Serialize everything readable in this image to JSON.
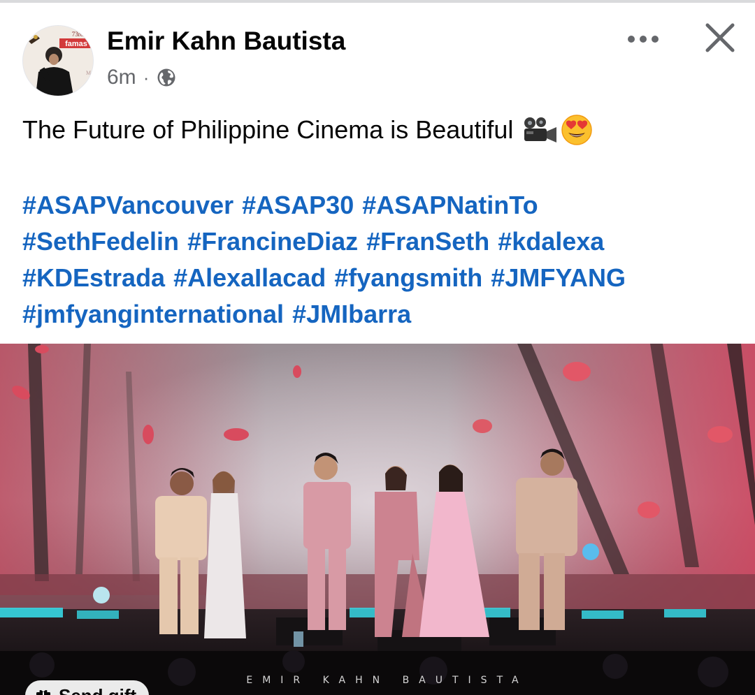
{
  "author": {
    "name": "Emir Kahn Bautista",
    "timestamp": "6m",
    "separator": "·",
    "privacy_icon": "globe-icon",
    "avatar_badge_text": "famas",
    "avatar_badge_number": "73rd"
  },
  "actions": {
    "more_icon": "more-horizontal-icon",
    "close_icon": "close-icon"
  },
  "post": {
    "text": "The Future of Philippine Cinema is Beautiful",
    "emojis": [
      "movie-camera-emoji",
      "heart-eyes-emoji"
    ],
    "hashtag_lines": [
      [
        "#ASAPVancouver",
        "#ASAP30",
        "#ASAPNatinTo"
      ],
      [
        "#SethFedelin",
        "#FrancineDiaz",
        "#FranSeth",
        "#kdalexa"
      ],
      [
        "#KDEstrada",
        "#AlexaIlacad",
        "#fyangsmith",
        "#JMFYANG"
      ],
      [
        "#jmfyanginternational",
        "#JMIbarra"
      ]
    ]
  },
  "photo": {
    "watermark": "EMIR KAHN BAUTISTA",
    "gift_chip_label": "Send gift"
  },
  "colors": {
    "hashtag": "#1565c0",
    "text": "#050505",
    "meta": "#65676b"
  }
}
